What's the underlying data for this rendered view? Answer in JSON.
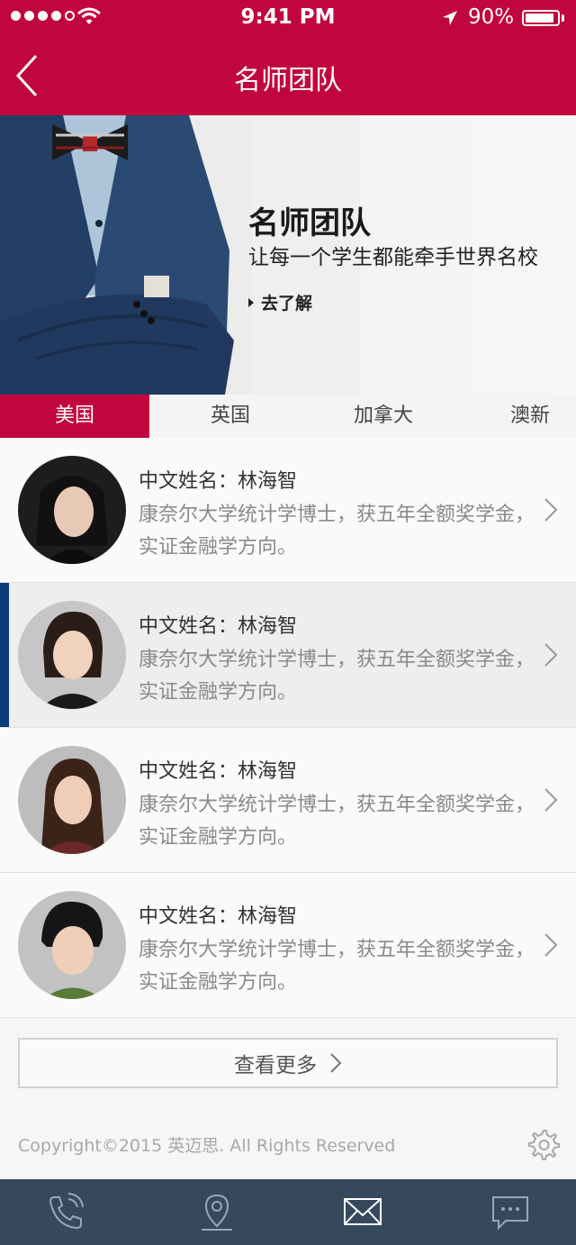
{
  "status_bar": {
    "time": "9:41 PM",
    "battery": "90%",
    "battery_level": 0.9
  },
  "header": {
    "title": "名师团队"
  },
  "banner": {
    "title": "名师团队",
    "subtitle": "让每一个学生都能牵手世界名校",
    "link": "去了解"
  },
  "tabs": [
    {
      "label": "美国",
      "active": true
    },
    {
      "label": "英国",
      "active": false
    },
    {
      "label": "加拿大",
      "active": false
    },
    {
      "label": "澳新",
      "active": false
    }
  ],
  "teachers": [
    {
      "name": "中文姓名：林海智",
      "desc": "康奈尔大学统计学博士，获五年全额奖学金，实证金融学方向。"
    },
    {
      "name": "中文姓名：林海智",
      "desc": "康奈尔大学统计学博士，获五年全额奖学金，实证金融学方向。"
    },
    {
      "name": "中文姓名：林海智",
      "desc": "康奈尔大学统计学博士，获五年全额奖学金，实证金融学方向。"
    },
    {
      "name": "中文姓名：林海智",
      "desc": "康奈尔大学统计学博士，获五年全额奖学金，实证金融学方向。"
    }
  ],
  "more_button": "查看更多",
  "footer": {
    "copyright": "Copyright©2015 英迈思. All Rights Reserved"
  },
  "colors": {
    "brand": "#c1053f",
    "tabbar": "#36485c",
    "selected_marker": "#0b3a78"
  },
  "tabbar_icons": [
    "phone-icon",
    "location-icon",
    "mail-icon",
    "chat-icon"
  ]
}
